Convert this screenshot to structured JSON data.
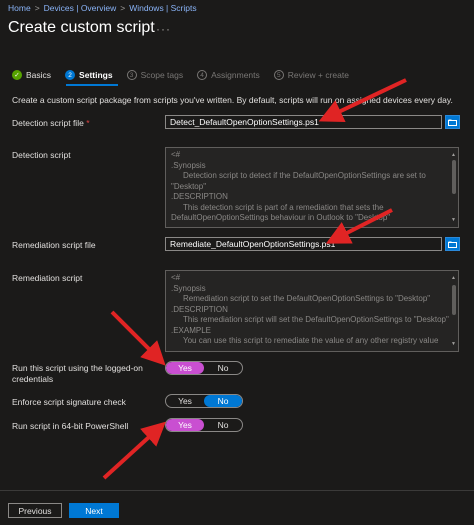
{
  "breadcrumb": {
    "items": [
      "Home",
      "Devices | Overview",
      "Windows | Scripts"
    ],
    "separator": ">"
  },
  "page_title": "Create custom script",
  "more_label": "···",
  "steps": [
    {
      "label": "Basics",
      "state": "done",
      "number": "✓"
    },
    {
      "label": "Settings",
      "state": "active",
      "number": "2"
    },
    {
      "label": "Scope tags",
      "state": "pending",
      "number": "3"
    },
    {
      "label": "Assignments",
      "state": "pending",
      "number": "4"
    },
    {
      "label": "Review + create",
      "state": "pending",
      "number": "5"
    }
  ],
  "intro": "Create a custom script package from scripts you've written. By default, scripts will run on assigned devices every day.",
  "detection": {
    "file_label": "Detection script file",
    "required_mark": "*",
    "file_value": "Detect_DefaultOpenOptionSettings.ps1",
    "script_label": "Detection script",
    "script_lines": [
      "<#",
      ".Synopsis",
      "Detection script to detect if the DefaultOpenOptionSettings are set to",
      "\"Desktop\"",
      ".DESCRIPTION",
      "This detection script is part of a remediation that sets the",
      "DefaultOpenOptionSettings behaviour in Outlook to \"Desktop\""
    ]
  },
  "remediation": {
    "file_label": "Remediation script file",
    "file_value": "Remediate_DefaultOpenOptionSettings.ps1",
    "script_label": "Remediation script",
    "script_lines": [
      "<#",
      ".Synopsis",
      "Remediation script to set the DefaultOpenOptionSettings to \"Desktop\"",
      ".DESCRIPTION",
      "This remediation script will set the DefaultOpenOptionSettings to \"Desktop\"",
      ".EXAMPLE",
      "You can use this script to remediate the value of any other registry value"
    ]
  },
  "toggles": {
    "logged_on": {
      "label_line1": "Run this script using the logged-on",
      "label_line2": "credentials",
      "yes": "Yes",
      "no": "No",
      "selected": "Yes"
    },
    "signature": {
      "label": "Enforce script signature check",
      "yes": "Yes",
      "no": "No",
      "selected": "No"
    },
    "ps64": {
      "label": "Run script in 64-bit PowerShell",
      "yes": "Yes",
      "no": "No",
      "selected": "Yes"
    }
  },
  "footer": {
    "previous": "Previous",
    "next": "Next"
  },
  "colors": {
    "accent": "#0078d4",
    "highlight": "#c94fd1",
    "arrow": "#e02424",
    "success": "#57a300"
  }
}
